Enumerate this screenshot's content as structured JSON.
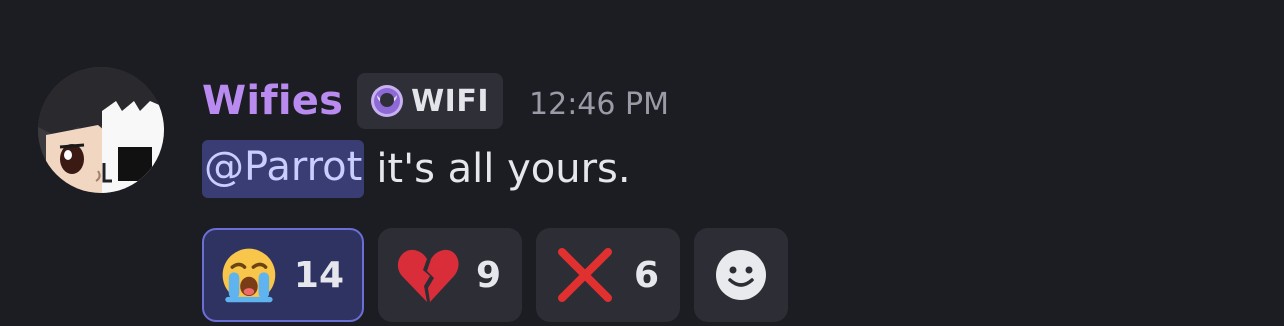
{
  "message": {
    "author": "Wifies",
    "tag": {
      "icon": "crescent-moon-icon",
      "label": "WIFI"
    },
    "timestamp": "12:46 PM",
    "mention": "@Parrot",
    "text": "it's all yours."
  },
  "reactions": [
    {
      "emoji": "loudly-crying-face-icon",
      "count": "14",
      "selected": true
    },
    {
      "emoji": "broken-heart-icon",
      "count": "9",
      "selected": false
    },
    {
      "emoji": "cross-mark-icon",
      "count": "6",
      "selected": false
    }
  ],
  "add_reaction": {
    "icon": "smiley-add-reaction-icon"
  },
  "colors": {
    "background": "#1c1d22",
    "username": "#b98bf0",
    "mention_bg": "#3a3d73",
    "selected_reaction_border": "#6a6fd6"
  }
}
